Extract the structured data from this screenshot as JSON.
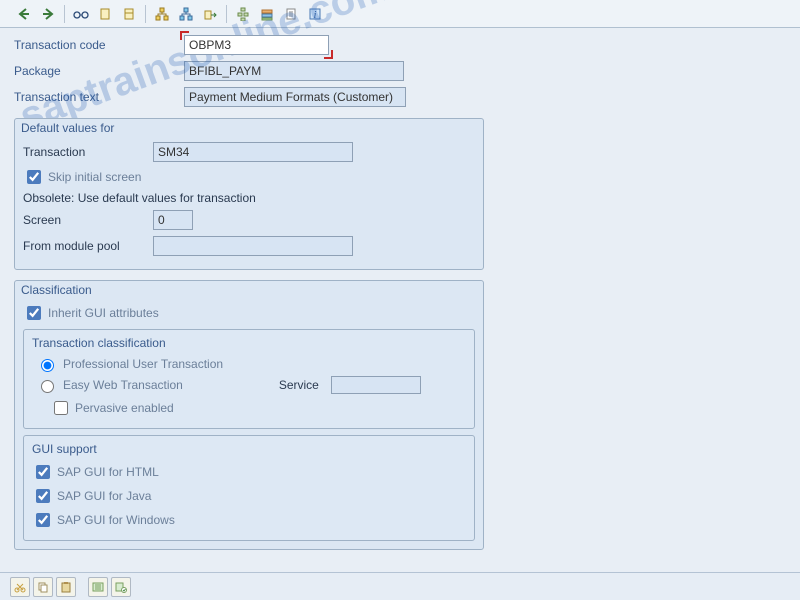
{
  "toolbar": {
    "back": "back-arrow",
    "forward": "forward-arrow"
  },
  "header": {
    "tcode_label": "Transaction code",
    "tcode_value": "OBPM3",
    "package_label": "Package",
    "package_value": "BFIBL_PAYM",
    "ttext_label": "Transaction text",
    "ttext_value": "Payment Medium Formats (Customer)"
  },
  "group1": {
    "title": "Default values for",
    "transaction_label": "Transaction",
    "transaction_value": "SM34",
    "skip_label": "Skip initial screen",
    "skip_checked": true,
    "obsolete_text": "Obsolete: Use default values for transaction",
    "screen_label": "Screen",
    "screen_value": "0",
    "modpool_label": "From module pool",
    "modpool_value": ""
  },
  "group2": {
    "title": "Classification",
    "inherit_label": "Inherit GUI attributes",
    "inherit_checked": true,
    "classification_title": "Transaction classification",
    "radio_prof": "Professional User Transaction",
    "radio_easy": "Easy Web Transaction",
    "service_label": "Service",
    "service_value": "",
    "pervasive_label": "Pervasive enabled",
    "gui_support_title": "GUI support",
    "gui_html_label": "SAP GUI for HTML",
    "gui_html_checked": true,
    "gui_java_label": "SAP GUI for Java",
    "gui_java_checked": true,
    "gui_win_label": "SAP GUI for Windows",
    "gui_win_checked": true
  },
  "watermark": "saptrainsonline.com"
}
